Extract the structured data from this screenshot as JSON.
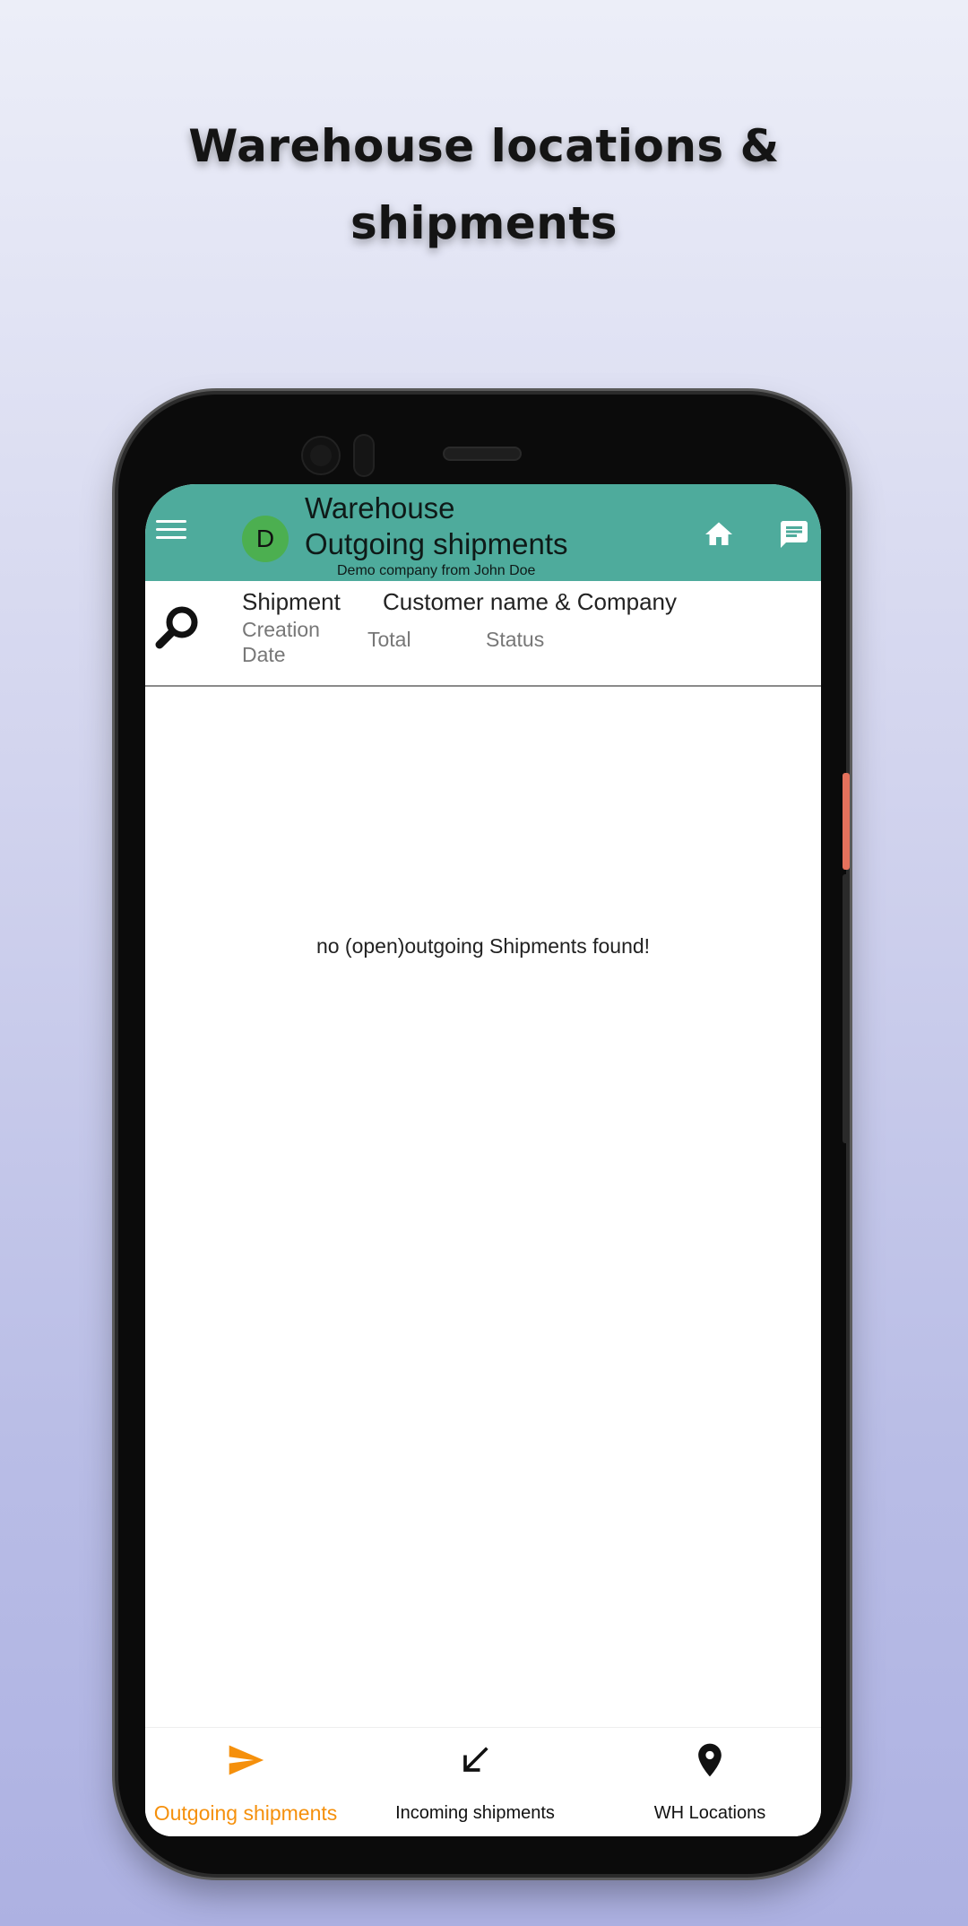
{
  "promo": {
    "headline_line1": "Warehouse locations &",
    "headline_line2": "shipments"
  },
  "appbar": {
    "avatar_letter": "D",
    "title_line1": "Warehouse",
    "title_line2": "Outgoing shipments",
    "subtitle": "Demo company from John Doe",
    "icons": [
      "menu-icon",
      "home-icon",
      "chat-icon"
    ],
    "color": "#4eab9c"
  },
  "list_header": {
    "shipment": "Shipment",
    "customer": "Customer name & Company",
    "creation_date": "Creation Date",
    "total": "Total",
    "status": "Status"
  },
  "empty_message": "no (open)outgoing Shipments found!",
  "bottom_nav": {
    "items": [
      {
        "label": "Outgoing shipments",
        "icon": "send-icon",
        "active": true
      },
      {
        "label": "Incoming shipments",
        "icon": "arrow-down-left-icon",
        "active": false
      },
      {
        "label": "WH Locations",
        "icon": "location-pin-icon",
        "active": false
      }
    ],
    "active_color": "#f5900c"
  }
}
